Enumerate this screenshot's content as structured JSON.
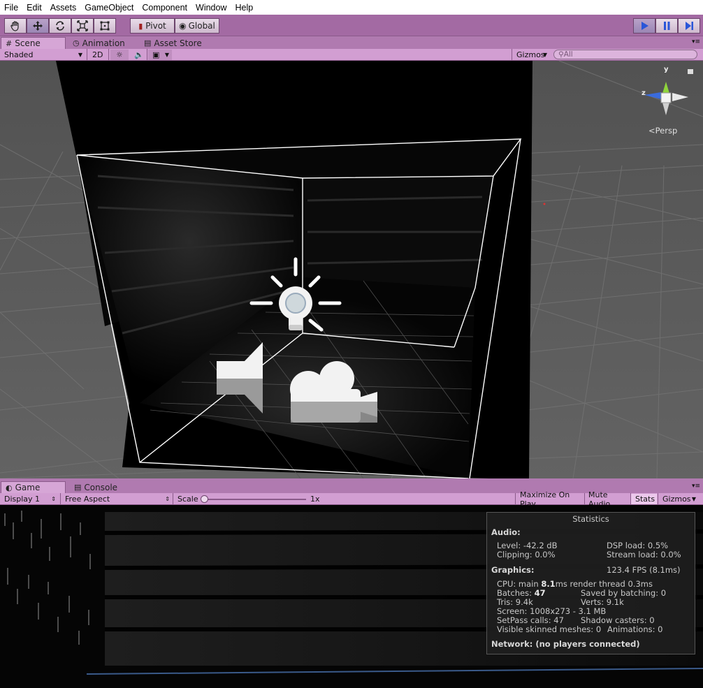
{
  "menu": [
    "File",
    "Edit",
    "Assets",
    "GameObject",
    "Component",
    "Window",
    "Help"
  ],
  "toolbar": {
    "tools": [
      {
        "name": "hand-tool-button",
        "icon": "hand-icon",
        "active": false
      },
      {
        "name": "move-tool-button",
        "icon": "move-icon",
        "active": true
      },
      {
        "name": "rotate-tool-button",
        "icon": "rotate-icon",
        "active": false
      },
      {
        "name": "scale-tool-button",
        "icon": "scale-icon",
        "active": false
      },
      {
        "name": "rect-tool-button",
        "icon": "rect-icon",
        "active": false
      }
    ],
    "pivot_label": "Pivot",
    "global_label": "Global",
    "play": {
      "icon": "play-icon",
      "active": true
    },
    "pause": {
      "icon": "pause-icon",
      "active": false
    },
    "step": {
      "icon": "step-icon",
      "active": false
    }
  },
  "scene_tabs": [
    {
      "label": "Scene",
      "icon": "grid-icon",
      "selected": true
    },
    {
      "label": "Animation",
      "icon": "clock-icon",
      "selected": false
    },
    {
      "label": "Asset Store",
      "icon": "store-icon",
      "selected": false
    }
  ],
  "scene_bar": {
    "shading": "Shaded",
    "mode_2d": "2D",
    "gizmos": "Gizmos",
    "search_placeholder": "All"
  },
  "scene_view": {
    "persp_label": "Persp",
    "axis_y": "y",
    "axis_z": "z"
  },
  "game_tabs": [
    {
      "label": "Game",
      "icon": "game-icon",
      "selected": true
    },
    {
      "label": "Console",
      "icon": "console-icon",
      "selected": false
    }
  ],
  "game_bar": {
    "display": "Display 1",
    "aspect": "Free Aspect",
    "scale_label": "Scale",
    "scale_value": "1x",
    "scale_fraction": 0.0,
    "maximize": "Maximize On Play",
    "mute": "Mute Audio",
    "stats": "Stats",
    "gizmos": "Gizmos"
  },
  "stats": {
    "title": "Statistics",
    "audio_header": "Audio:",
    "level": "Level: -42.2 dB",
    "dsp": "DSP load: 0.5%",
    "clipping": "Clipping: 0.0%",
    "stream": "Stream load: 0.0%",
    "graphics_header": "Graphics:",
    "fps": "123.4 FPS (8.1ms)",
    "cpu_prefix": "CPU: main ",
    "cpu_main": "8.1",
    "cpu_suffix": "ms  render thread 0.3ms",
    "batches_prefix": "Batches: ",
    "batches": "47",
    "saved": "Saved by batching: 0",
    "tris": "Tris: 9.4k",
    "verts": "Verts: 9.1k",
    "screen": "Screen: 1008x273 - 3.1 MB",
    "setpass": "SetPass calls: 47",
    "shadow": "Shadow casters: 0",
    "skinned": "Visible skinned meshes: 0",
    "animations": "Animations: 0",
    "network": "Network: (no players connected)"
  }
}
